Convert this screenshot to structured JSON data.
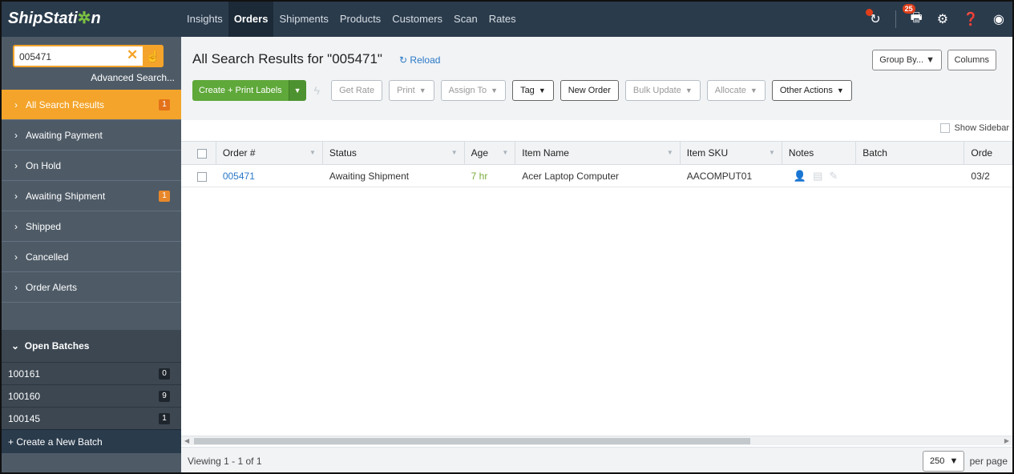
{
  "app": {
    "logo": "ShipStati",
    "logo_gear": "✲",
    "logo_tail": "n"
  },
  "nav": {
    "links": [
      "Insights",
      "Orders",
      "Shipments",
      "Products",
      "Customers",
      "Scan",
      "Rates"
    ],
    "active": "Orders",
    "printer_badge": "25"
  },
  "sidebar": {
    "search_value": "005471",
    "advanced_search": "Advanced Search...",
    "statuses": [
      {
        "label": "All Search Results",
        "count": "1"
      },
      {
        "label": "Awaiting Payment",
        "count": ""
      },
      {
        "label": "On Hold",
        "count": ""
      },
      {
        "label": "Awaiting Shipment",
        "count": "1"
      },
      {
        "label": "Shipped",
        "count": ""
      },
      {
        "label": "Cancelled",
        "count": ""
      },
      {
        "label": "Order Alerts",
        "count": ""
      }
    ],
    "open_batches_label": "Open Batches",
    "batches": [
      {
        "id": "100161",
        "count": "0"
      },
      {
        "id": "100160",
        "count": "9"
      },
      {
        "id": "100145",
        "count": "1"
      }
    ],
    "create_batch": "+ Create a New Batch"
  },
  "main": {
    "title": "All Search Results for \"005471\"",
    "reload": "Reload",
    "group_by": "Group By...",
    "columns": "Columns",
    "create_print": "Create + Print Labels",
    "actions": {
      "get_rate": "Get Rate",
      "print": "Print",
      "assign_to": "Assign To",
      "tag": "Tag",
      "new_order": "New Order",
      "bulk_update": "Bulk Update",
      "allocate": "Allocate",
      "other_actions": "Other Actions"
    },
    "show_sidebar": "Show Sidebar"
  },
  "table": {
    "headers": {
      "order": "Order #",
      "status": "Status",
      "age": "Age",
      "item_name": "Item Name",
      "item_sku": "Item SKU",
      "notes": "Notes",
      "batch": "Batch",
      "order_date": "Orde"
    },
    "rows": [
      {
        "order": "005471",
        "status": "Awaiting Shipment",
        "age": "7 hr",
        "item_name": "Acer Laptop Computer",
        "item_sku": "AACOMPUT01",
        "batch": "",
        "order_date": "03/2"
      }
    ]
  },
  "footer": {
    "viewing": "Viewing 1 - 1 of 1",
    "per_page_value": "250",
    "per_page_label": "per page"
  },
  "colors": {
    "nav_bg": "#2a3b4c",
    "sidebar_bg": "#4e5b67",
    "accent_orange": "#f4a42a",
    "accent_green": "#5fa83a",
    "link_blue": "#2a78c8"
  }
}
